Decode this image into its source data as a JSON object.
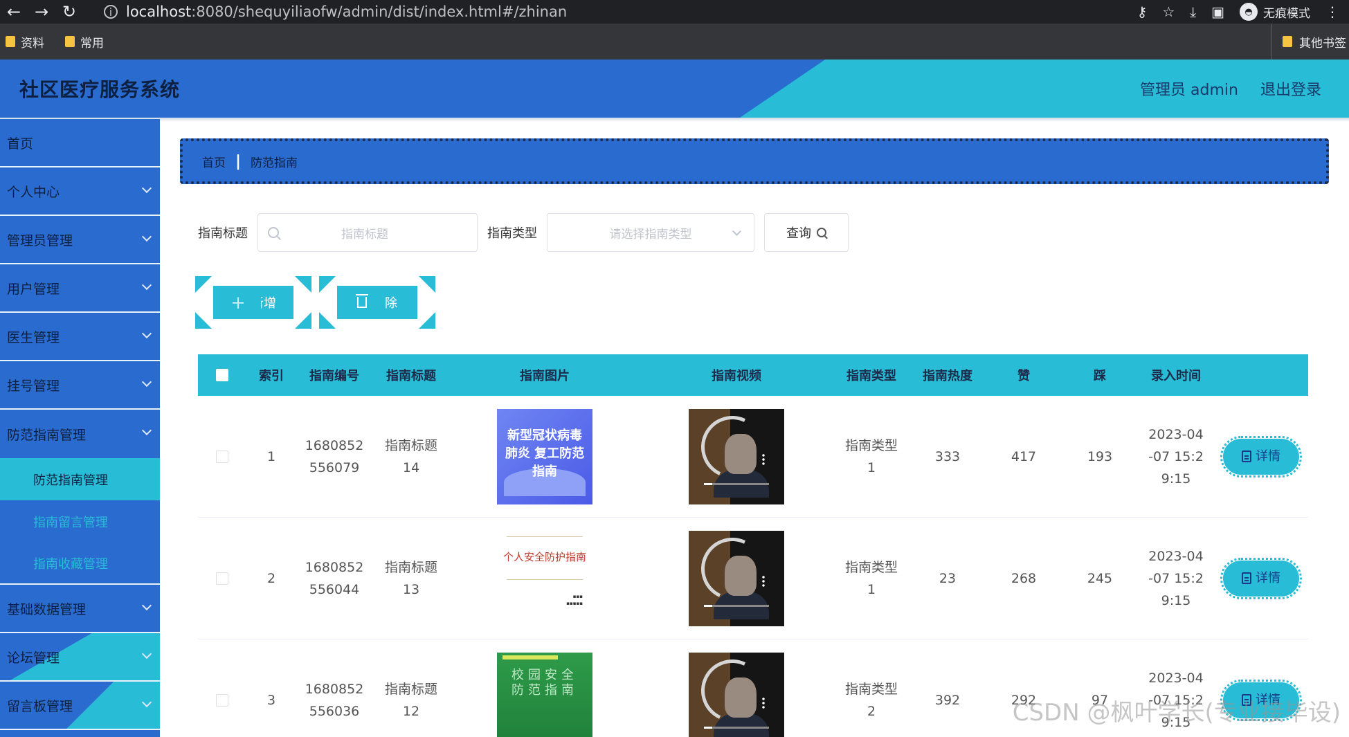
{
  "browser": {
    "url_host": "localhost",
    "url_path": ":8080/shequyiliaofw/admin/dist/index.html#/zhinan",
    "incognito_label": "无痕模式",
    "bookmarks": [
      "资料",
      "常用"
    ],
    "other_bookmarks": "其他书签"
  },
  "header": {
    "title": "社区医疗服务系统",
    "user": "管理员 admin",
    "logout": "退出登录"
  },
  "sidebar": {
    "items": [
      {
        "label": "首页",
        "expandable": false
      },
      {
        "label": "个人中心",
        "expandable": true
      },
      {
        "label": "管理员管理",
        "expandable": true
      },
      {
        "label": "用户管理",
        "expandable": true
      },
      {
        "label": "医生管理",
        "expandable": true
      },
      {
        "label": "挂号管理",
        "expandable": true
      },
      {
        "label": "防范指南管理",
        "expandable": true
      }
    ],
    "subitems": [
      "防范指南管理",
      "指南留言管理",
      "指南收藏管理"
    ],
    "items_after": [
      {
        "label": "基础数据管理"
      },
      {
        "label": "论坛管理"
      },
      {
        "label": "留言板管理"
      }
    ]
  },
  "breadcrumb": {
    "home": "首页",
    "current": "防范指南"
  },
  "search": {
    "title_label": "指南标题",
    "title_placeholder": "指南标题",
    "type_label": "指南类型",
    "type_placeholder": "请选择指南类型",
    "query_button": "查询"
  },
  "actions": {
    "add": "新增",
    "delete": "删除"
  },
  "table": {
    "headers": [
      "索引",
      "指南编号",
      "指南标题",
      "指南图片",
      "指南视频",
      "指南类型",
      "指南热度",
      "赞",
      "踩",
      "录入时间"
    ],
    "detail_label": "详情",
    "rows": [
      {
        "index": "1",
        "no_a": "1680852",
        "no_b": "556079",
        "title_a": "指南标题",
        "title_b": "14",
        "img_text": "新型冠状病毒肺炎 复工防范指南",
        "type_a": "指南类型",
        "type_b": "1",
        "heat": "333",
        "like": "417",
        "dislike": "193",
        "time_a": "2023-04",
        "time_b": "-07 15:2",
        "time_c": "9:15"
      },
      {
        "index": "2",
        "no_a": "1680852",
        "no_b": "556044",
        "title_a": "指南标题",
        "title_b": "13",
        "img_text": "个人安全防护指南",
        "type_a": "指南类型",
        "type_b": "1",
        "heat": "23",
        "like": "268",
        "dislike": "245",
        "time_a": "2023-04",
        "time_b": "-07 15:2",
        "time_c": "9:15"
      },
      {
        "index": "3",
        "no_a": "1680852",
        "no_b": "556036",
        "title_a": "指南标题",
        "title_b": "12",
        "img_text": "校园安全 防范指南",
        "type_a": "指南类型",
        "type_b": "2",
        "heat": "392",
        "like": "292",
        "dislike": "97",
        "time_a": "2023-04",
        "time_b": "-07 15:2",
        "time_c": "9:15"
      }
    ]
  },
  "watermark": "CSDN @枫叶学长(专业接毕设)",
  "colors": {
    "primary_blue": "#2a6bd0",
    "accent_cyan": "#28bcd6"
  }
}
